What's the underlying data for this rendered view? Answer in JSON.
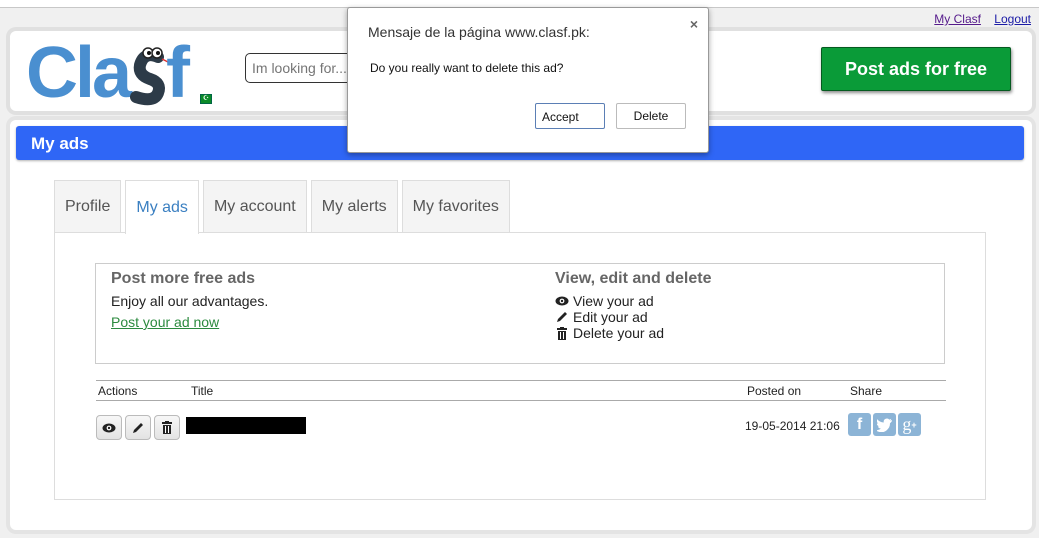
{
  "top_links": {
    "my_clasf": "My Clasf",
    "logout": "Logout"
  },
  "header": {
    "logo_text": "Clasf",
    "search_placeholder": "Im looking for...",
    "post_button": "Post ads for free",
    "flag": "pakistan-flag"
  },
  "page": {
    "title": "My ads"
  },
  "tabs": [
    {
      "label": "Profile",
      "active": false
    },
    {
      "label": "My ads",
      "active": true
    },
    {
      "label": "My account",
      "active": false
    },
    {
      "label": "My alerts",
      "active": false
    },
    {
      "label": "My favorites",
      "active": false
    }
  ],
  "info": {
    "left": {
      "heading": "Post more free ads",
      "text": "Enjoy all our advantages.",
      "link": "Post your ad now"
    },
    "right": {
      "heading": "View, edit and delete",
      "items": [
        {
          "icon": "eye-icon",
          "label": "View your ad"
        },
        {
          "icon": "pencil-icon",
          "label": "Edit your ad"
        },
        {
          "icon": "trash-icon",
          "label": "Delete your ad"
        }
      ]
    }
  },
  "table": {
    "headers": {
      "actions": "Actions",
      "title": "Title",
      "posted_on": "Posted on",
      "share": "Share"
    },
    "rows": [
      {
        "title": "[redacted]",
        "posted_on": "19-05-2014 21:06",
        "share": [
          "facebook",
          "twitter",
          "google-plus"
        ]
      }
    ]
  },
  "dialog": {
    "title": "Mensaje de la página www.clasf.pk:",
    "message": "Do you really want to delete this ad?",
    "accept": "Accept",
    "delete": "Delete",
    "close": "×"
  },
  "colors": {
    "title_bar": "#2f66f6",
    "post_button": "#0a9b38",
    "active_tab": "#3a7fc1",
    "link_green": "#2b8a3e",
    "share_icon": "#8cb4d6",
    "logo_blue": "#4a8fd0"
  }
}
